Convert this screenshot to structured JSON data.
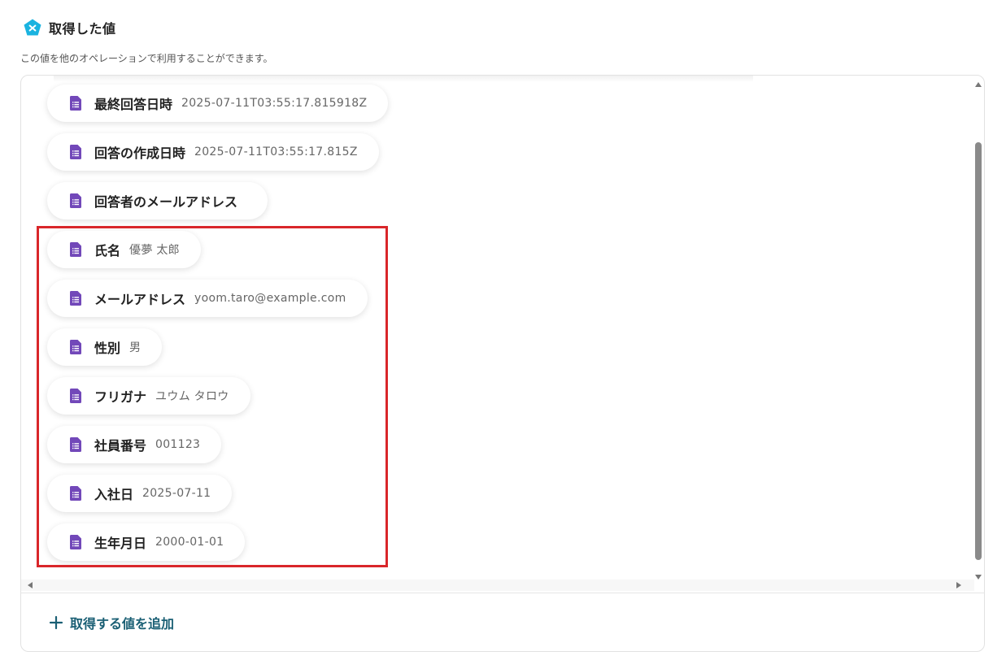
{
  "header": {
    "title": "取得した値",
    "icon": "yoom-pentagon-icon",
    "icon_color": "#1ab3e0"
  },
  "subtitle": "この値を他のオペレーションで利用することができます。",
  "fields": [
    {
      "label": "最終回答日時",
      "value": "2025-07-11T03:55:17.815918Z"
    },
    {
      "label": "回答の作成日時",
      "value": "2025-07-11T03:55:17.815Z"
    },
    {
      "label": "回答者のメールアドレス",
      "value": ""
    },
    {
      "label": "氏名",
      "value": "優夢 太郎"
    },
    {
      "label": "メールアドレス",
      "value": "yoom.taro@example.com"
    },
    {
      "label": "性別",
      "value": "男"
    },
    {
      "label": "フリガナ",
      "value": "ユウム タロウ"
    },
    {
      "label": "社員番号",
      "value": "001123"
    },
    {
      "label": "入社日",
      "value": "2025-07-11"
    },
    {
      "label": "生年月日",
      "value": "2000-01-01"
    }
  ],
  "field_icon": "google-forms-icon",
  "field_icon_color": "#7248b9",
  "highlight_color": "#d9262a",
  "footer": {
    "add_label": "取得する値を追加",
    "add_color": "#1a5f74"
  }
}
